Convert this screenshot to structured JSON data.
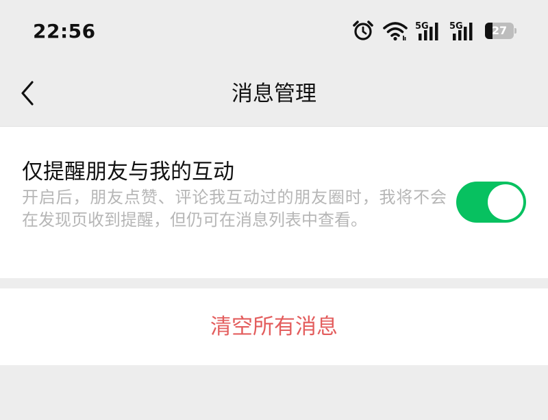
{
  "status_bar": {
    "time": "22:56",
    "icons": [
      "alarm-clock-icon",
      "wifi-icon",
      "5g-signal-icon",
      "5g-signal-icon"
    ],
    "network_label_1": "5G",
    "network_label_2": "5G",
    "battery_level": "27",
    "battery_fraction": 0.27
  },
  "nav": {
    "back_icon": "chevron-left-icon",
    "title": "消息管理"
  },
  "setting": {
    "title": "仅提醒朋友与我的互动",
    "description": "开启后，朋友点赞、评论我互动过的朋友圈时，我将不会在发现页收到提醒，但仍可在消息列表中查看。",
    "enabled": true,
    "toggle_color": "#07c160"
  },
  "action": {
    "clear_label": "清空所有消息",
    "color": "#e35d5d"
  }
}
